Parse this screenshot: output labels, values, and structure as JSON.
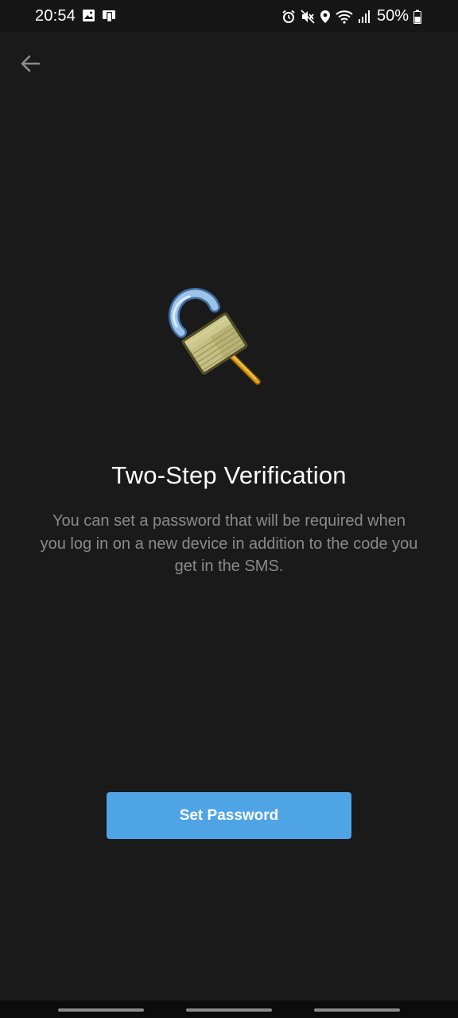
{
  "status_bar": {
    "time": "20:54",
    "battery_text": "50%",
    "left_icons": [
      "image-icon",
      "device-icon"
    ],
    "right_icons": [
      "alarm-icon",
      "mute-icon",
      "location-icon",
      "wifi-icon",
      "signal-icon",
      "battery-icon"
    ]
  },
  "toolbar": {
    "back_icon": "arrow-left-icon"
  },
  "illustration": {
    "icon": "unlocked-padlock-with-key-icon"
  },
  "content": {
    "title": "Two-Step Verification",
    "description": "You can set a password that will be required when you log in on a new device in addition to the code you get in the SMS."
  },
  "actions": {
    "set_password_label": "Set Password"
  },
  "colors": {
    "background": "#1a1a1a",
    "accent": "#4fa4e6",
    "title_text": "#ffffff",
    "secondary_text": "#8a8a8a"
  }
}
